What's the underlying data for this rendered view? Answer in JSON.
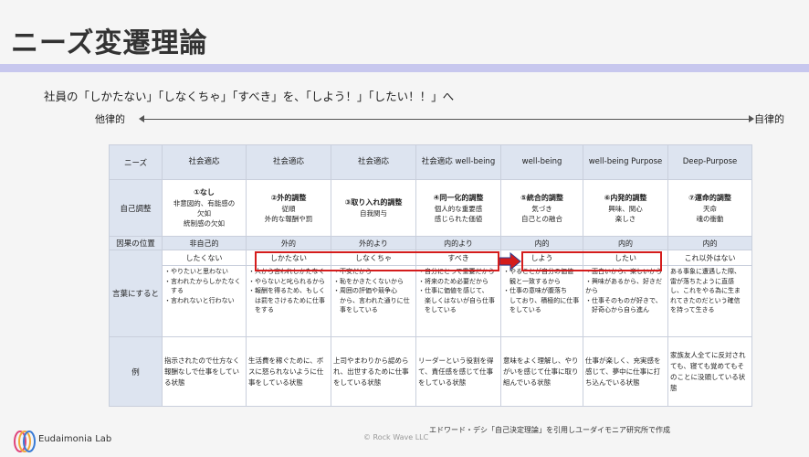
{
  "title": "ニーズ変遷理論",
  "subtitle": "社員の「しかたない」「しなくちゃ」「すべき」を、「しよう！」「したい！！」へ",
  "axis": {
    "left": "他律的",
    "right": "自律的"
  },
  "table": {
    "row_labels": {
      "needs": "ニーズ",
      "self_regulation": "自己調整",
      "locus": "因果の位置",
      "words": "言葉にすると",
      "example": "例"
    },
    "columns": [
      {
        "needs": "社会適応",
        "reg_title": "①なし",
        "reg_lines": [
          "非意図的、有能感の",
          "欠如",
          "統制感の欠如"
        ],
        "locus": "非自己的",
        "phrase": "したくない",
        "word_lines": [
          "・やりたいと思わない",
          "・言われたからしかたなく",
          "　する",
          "・言われないと行わない"
        ],
        "example": "指示されたので仕方なく報酬なしで仕事をしている状態"
      },
      {
        "needs": "社会適応",
        "reg_title": "②外的調整",
        "reg_lines": [
          "従順",
          "外的な報酬や罰"
        ],
        "locus": "外的",
        "phrase": "しかたない",
        "word_lines": [
          "・人から言われしかたなく",
          "・やらないと叱られるから",
          "・報酬を得るため、もしく",
          "　は罰をさけるために仕事",
          "　をする"
        ],
        "example": "生活費を稼ぐために、ボスに怒られないように仕事をしている状態"
      },
      {
        "needs": "社会適応",
        "reg_title": "③取り入れ的調整",
        "reg_lines": [
          "自我関与"
        ],
        "locus": "外的より",
        "phrase": "しなくちゃ",
        "word_lines": [
          "・不安だから",
          "・恥をかきたくないから",
          "・周囲の評価や競争心",
          "　から、言われた通りに仕",
          "　事をしている"
        ],
        "example": "上司やまわりから認められ、出世するために仕事をしている状態"
      },
      {
        "needs": "社会適応 well-being",
        "reg_title": "④同一化的調整",
        "reg_lines": [
          "個人的な重要感",
          "感じられた価値"
        ],
        "locus": "内的より",
        "phrase": "すべき",
        "word_lines": [
          "・自分にとって重要だから",
          "・将来のため必要だから",
          "・仕事に価値を感じて、",
          "　楽しくはないが自ら仕事",
          "　をしている"
        ],
        "example": "リーダーという役割を得て、責任感を感じて仕事をしている状態"
      },
      {
        "needs": "well-being",
        "reg_title": "⑤統合的調整",
        "reg_lines": [
          "気づき",
          "自己との融合"
        ],
        "locus": "内的",
        "phrase": "しよう",
        "word_lines": [
          "・やることが自分の価値",
          "　観と一致するから",
          "・仕事の意味が腹落ち",
          "　しており、積極的に仕事",
          "　をしている"
        ],
        "example": "意味をよく理解し、やりがいを感じて仕事に取り組んでいる状態"
      },
      {
        "needs": "well-being Purpose",
        "reg_title": "⑥内発的調整",
        "reg_lines": [
          "興味、関心",
          "楽しさ"
        ],
        "locus": "内的",
        "phrase": "したい",
        "word_lines": [
          "・面白いから、楽しいから",
          "・興味があるから、好きだから",
          "・仕事そのものが好きで、",
          "　好奇心から自ら進ん"
        ],
        "example": "仕事が楽しく、充実感を感じて、夢中に仕事に打ち込んでいる状態"
      },
      {
        "needs": "Deep-Purpose",
        "reg_title": "⑦運命的調整",
        "reg_lines": [
          "天命",
          "魂の衝動"
        ],
        "locus": "内的",
        "phrase": "これ以外はない",
        "word_lines": [
          "ある事象に遭遇した際、",
          "雷が落ちたように直感",
          "し、これをやる為に生ま",
          "れてきたのだという確信",
          "を持って生きる"
        ],
        "example": "家族友人全てに反対されても、寝ても覚めてもそのことに没頭している状態"
      }
    ]
  },
  "footer": {
    "logo_text": "Eudaimonia Lab",
    "credit": "エドワード・デシ「自己決定理論」を引用しユーダイモニア研究所で作成",
    "copyright": "© Rock Wave LLC"
  },
  "colors": {
    "accent_bar": "#c7c7ee",
    "highlight_border": "#d41c1c",
    "arrow": "#d41c1c",
    "table_header": "#dde4f0"
  }
}
